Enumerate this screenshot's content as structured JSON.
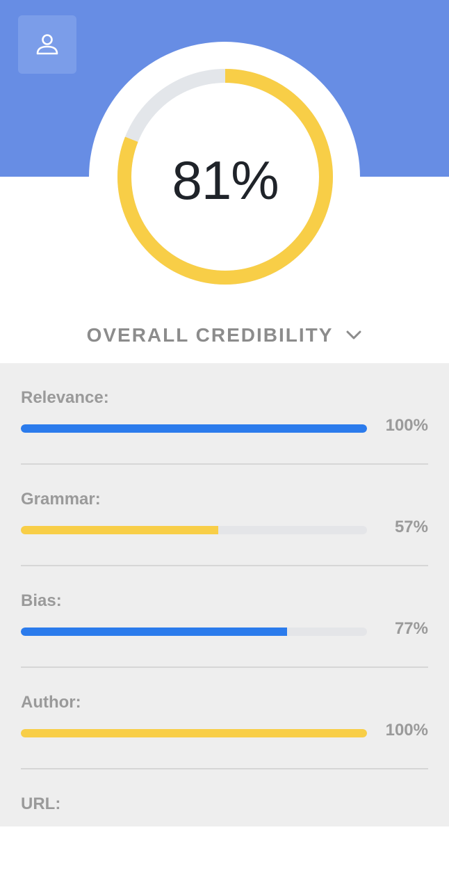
{
  "header": {
    "profile_icon": "person-icon",
    "band_color": "#678de4"
  },
  "credibility": {
    "value": 81,
    "value_label": "81%",
    "title": "OVERALL CREDIBILITY",
    "dropdown_icon": "chevron-down-icon",
    "ring_color": "#f8ce47",
    "track_color": "#e3e6ea"
  },
  "metrics": [
    {
      "label": "Relevance:",
      "percent": 100,
      "value_label": "100%",
      "color": "#2b7bec"
    },
    {
      "label": "Grammar:",
      "percent": 57,
      "value_label": "57%",
      "color": "#f8ce47"
    },
    {
      "label": "Bias:",
      "percent": 77,
      "value_label": "77%",
      "color": "#2b7bec"
    },
    {
      "label": "Author:",
      "percent": 100,
      "value_label": "100%",
      "color": "#f8ce47"
    },
    {
      "label": "URL:"
    }
  ]
}
